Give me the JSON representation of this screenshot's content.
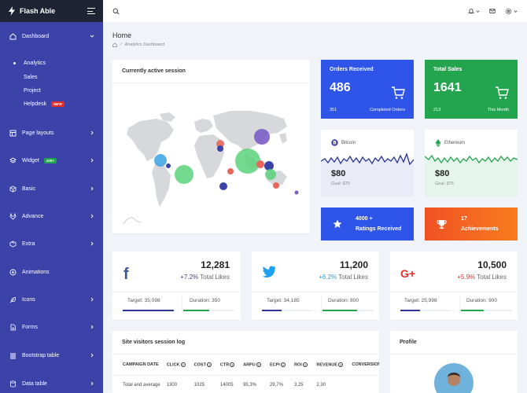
{
  "brand": {
    "name": "Flash Able"
  },
  "sidebar": {
    "items": [
      {
        "label": "Dashboard",
        "icon": "home-icon"
      },
      {
        "label": "Page layouts",
        "icon": "layout-icon"
      },
      {
        "label": "Widget",
        "icon": "layers-icon",
        "badge": "100+"
      },
      {
        "label": "Basic",
        "icon": "box-icon"
      },
      {
        "label": "Advance",
        "icon": "gitlab-icon"
      },
      {
        "label": "Extra",
        "icon": "package-icon"
      },
      {
        "label": "Animations",
        "icon": "aperture-icon"
      },
      {
        "label": "Icons",
        "icon": "feather-icon"
      },
      {
        "label": "Forms",
        "icon": "file-text-icon"
      },
      {
        "label": "Bootstrap table",
        "icon": "align-justify-icon"
      },
      {
        "label": "Data table",
        "icon": "database-icon"
      }
    ],
    "dashboard_sub": [
      {
        "label": "Analytics"
      },
      {
        "label": "Sales"
      },
      {
        "label": "Project"
      },
      {
        "label": "Helpdesk",
        "badge": "NEW"
      }
    ]
  },
  "page": {
    "title": "Home",
    "breadcrumb": "Analytics Dashboard"
  },
  "session_card": {
    "title": "Currently active session"
  },
  "orders": {
    "title": "Orders Received",
    "value": "486",
    "left": "351",
    "right": "Completed Orders",
    "color": "#2f54e8"
  },
  "sales": {
    "title": "Total Sales",
    "value": "1641",
    "left": "213",
    "right": "This Month",
    "color": "#23a44e"
  },
  "bitcoin": {
    "name": "Bitcoin",
    "price": "$80",
    "goal": "Goal: $75"
  },
  "ethereum": {
    "name": "Ethereum",
    "price": "$80",
    "goal": "Goal: $75"
  },
  "ratings": {
    "line1": "4000 +",
    "line2": "Ratings Received"
  },
  "achievements": {
    "line1": "17",
    "line2": "Achievements"
  },
  "social": [
    {
      "network": "facebook",
      "value": "12,281",
      "change": "+7.2%",
      "label": "Total Likes",
      "target_label": "Target: 35,098",
      "duration_label": "Duration: 350",
      "target_pct": 0.7,
      "duration_pct": 0.5
    },
    {
      "network": "twitter",
      "value": "11,200",
      "change": "+6.2%",
      "label": "Total Likes",
      "target_label": "Target: 34,185",
      "duration_label": "Duration: 800",
      "target_pct": 0.4,
      "duration_pct": 0.6
    },
    {
      "network": "google-plus",
      "value": "10,500",
      "change": "+5.9%",
      "label": "Total Likes",
      "target_label": "Target: 25,998",
      "duration_label": "Duration: 900",
      "target_pct": 0.4,
      "duration_pct": 0.6
    }
  ],
  "session_log": {
    "title": "Site visitors session log",
    "columns": [
      "CAMPAIGN DATE",
      "CLICK",
      "COST",
      "CTR",
      "ARPU",
      "ECPI",
      "ROI",
      "REVENUE",
      "CONVERSIONS"
    ],
    "rows": [
      [
        "Total and average",
        "1300",
        "1025",
        "14005",
        "95,3%",
        "29,7%",
        "3,25",
        "2,30",
        ""
      ]
    ]
  },
  "profile": {
    "title": "Profile"
  }
}
